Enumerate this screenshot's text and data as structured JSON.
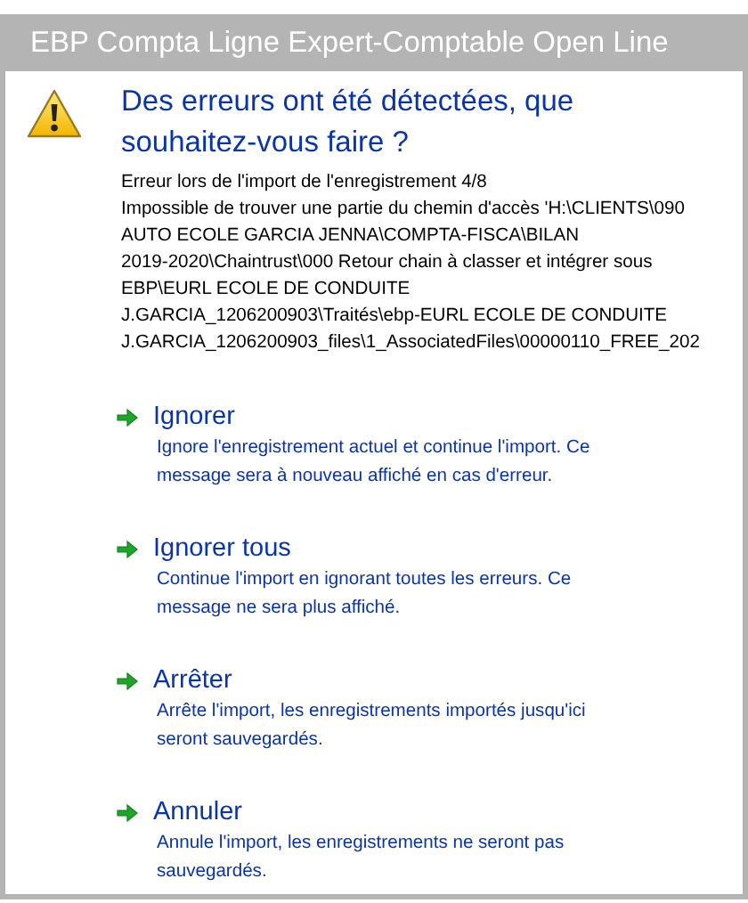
{
  "window": {
    "title": "EBP Compta Ligne Expert-Comptable Open Line"
  },
  "heading": "Des erreurs ont été détectées, que souhaitez-vous faire ?",
  "details": [
    "Erreur lors de l'import de l'enregistrement 4/8",
    "Impossible de trouver une partie du chemin d'accès 'H:\\CLIENTS\\090",
    "AUTO ECOLE GARCIA JENNA\\COMPTA-FISCA\\BILAN",
    "2019-2020\\Chaintrust\\000 Retour chain à classer et intégrer sous",
    "EBP\\EURL ECOLE DE CONDUITE",
    "J.GARCIA_1206200903\\Traités\\ebp-EURL ECOLE DE CONDUITE",
    "J.GARCIA_1206200903_files\\1_AssociatedFiles\\00000110_FREE_202"
  ],
  "options": [
    {
      "title": "Ignorer",
      "description": "Ignore l'enregistrement actuel et continue l'import. Ce message sera à nouveau affiché en cas d'erreur."
    },
    {
      "title": "Ignorer tous",
      "description": "Continue l'import en ignorant toutes les erreurs. Ce message ne sera plus affiché."
    },
    {
      "title": "Arrêter",
      "description": "Arrête l'import, les enregistrements importés jusqu'ici seront sauvegardés."
    },
    {
      "title": "Annuler",
      "description": "Annule l'import, les enregistrements ne seront pas sauvegardés."
    }
  ]
}
